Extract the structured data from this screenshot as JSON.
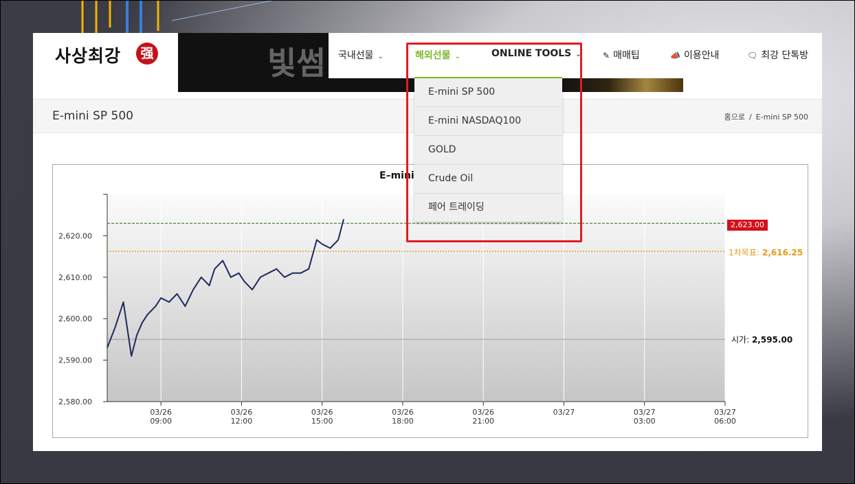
{
  "site": {
    "logo_text": "사상최강",
    "logo_seal": "强"
  },
  "banner": {
    "text": "빛썸"
  },
  "nav": {
    "items": [
      {
        "label": "국내선물",
        "chevron": "chevron-down-icon"
      },
      {
        "label": "해외선물",
        "chevron": "chevron-down-icon"
      },
      {
        "label": "ONLINE TOOLS",
        "chevron": "chevron-down-icon"
      },
      {
        "label": "매매팁",
        "icon": "edit-icon"
      },
      {
        "label": "이용안내",
        "icon": "megaphone-icon"
      },
      {
        "label": "최강 단톡방",
        "icon": "chat-icon"
      }
    ],
    "active_color": "#7cb829"
  },
  "dropdown": {
    "items": [
      "E-mini SP 500",
      "E-mini NASDAQ100",
      "GOLD",
      "Crude Oil",
      "페어 트레이딩"
    ]
  },
  "page": {
    "title": "E-mini SP 500",
    "breadcrumb": {
      "home": "홈으로",
      "separator": "/",
      "current": "E-mini SP 500"
    }
  },
  "chart": {
    "title_visible": "E–mini",
    "price_tag": "2,623.00",
    "target_label": "1차목표:",
    "target_value": "2,616.25",
    "open_label": "시가:",
    "open_value": "2,595.00",
    "colors": {
      "line": "#1c2a5c",
      "price": "#d4101a",
      "target": "#e79a17",
      "current_line": "#2b6a16"
    }
  },
  "chart_data": {
    "type": "line",
    "title": "E–mini",
    "y_ticks": [
      "2,580.00",
      "2,590.00",
      "2,600.00",
      "2,610.00",
      "2,620.00"
    ],
    "ylim": [
      2580,
      2630
    ],
    "x_ticks": [
      {
        "date": "03/26",
        "time": "09:00"
      },
      {
        "date": "03/26",
        "time": "12:00"
      },
      {
        "date": "03/26",
        "time": "15:00"
      },
      {
        "date": "03/26",
        "time": "18:00"
      },
      {
        "date": "03/26",
        "time": "21:00"
      },
      {
        "date": "03/27",
        "time": ""
      },
      {
        "date": "03/27",
        "time": "03:00"
      },
      {
        "date": "03/27",
        "time": "06:00"
      }
    ],
    "xlim_hours": [
      7,
      30
    ],
    "reference_lines": {
      "current": 2623.0,
      "target": 2616.25,
      "open": 2595.0
    },
    "series": [
      {
        "values_hours": [
          7.0,
          7.3,
          7.6,
          7.9,
          8.1,
          8.3,
          8.5,
          8.8,
          9.0,
          9.3,
          9.6,
          9.9,
          10.2,
          10.5,
          10.8,
          11.0,
          11.3,
          11.6,
          11.9,
          12.1,
          12.4,
          12.7,
          13.0,
          13.3,
          13.6,
          13.9,
          14.2,
          14.5,
          14.8,
          15.0,
          15.3,
          15.6,
          15.8
        ],
        "values": [
          2593,
          2598,
          2604,
          2591,
          2596,
          2599,
          2601,
          2603,
          2605,
          2604,
          2606,
          2603,
          2607,
          2610,
          2608,
          2612,
          2614,
          2610,
          2611,
          2609,
          2607,
          2610,
          2611,
          2612,
          2610,
          2611,
          2611,
          2612,
          2619,
          2618,
          2617,
          2619,
          2624
        ]
      }
    ],
    "grid": true
  }
}
